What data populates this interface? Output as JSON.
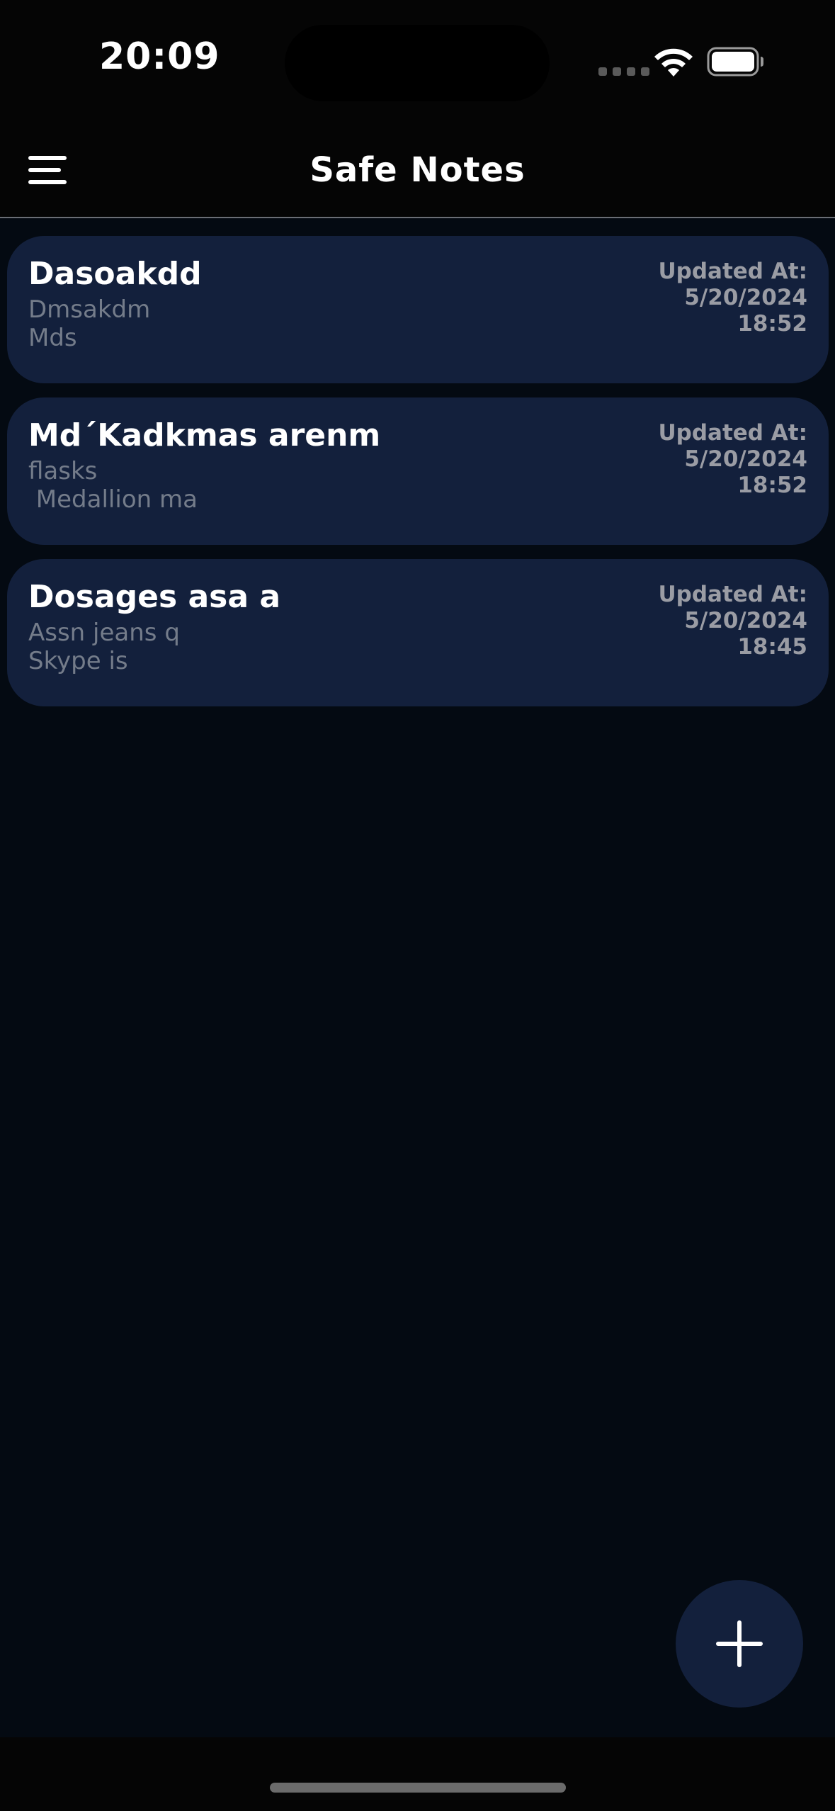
{
  "status_bar": {
    "time": "20:09"
  },
  "nav": {
    "title": "Safe Notes",
    "menu_icon": "hamburger-menu-icon"
  },
  "notes": [
    {
      "title": "Dasoakdd",
      "line1": "Dmsakdm",
      "line2": "Mds",
      "updated_label": "Updated At:",
      "date": "5/20/2024",
      "time": "18:52"
    },
    {
      "title": "MdˊKadkmas arenm",
      "line1": "flasks",
      "line2": " Medallion ma",
      "updated_label": "Updated At:",
      "date": "5/20/2024",
      "time": "18:52"
    },
    {
      "title": "Dosages asa a",
      "line1": "Assn jeans q",
      "line2": "Skype is",
      "updated_label": "Updated At:",
      "date": "5/20/2024",
      "time": "18:45"
    }
  ],
  "fab": {
    "icon": "plus-icon"
  },
  "colors": {
    "background": "#040a12",
    "card": "#13203c",
    "title_text": "#ffffff",
    "body_text": "#747c8a",
    "meta_text": "#9a9ca4"
  }
}
